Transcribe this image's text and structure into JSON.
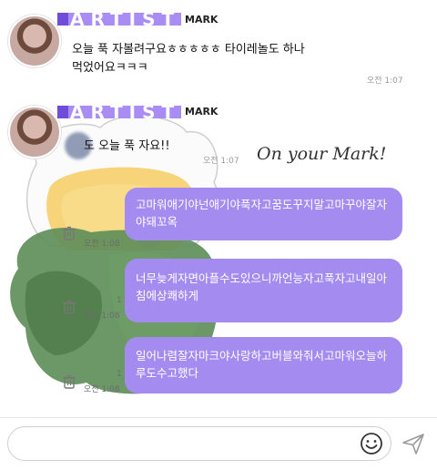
{
  "post1": {
    "badge": "ARTIST",
    "artist": "MARK",
    "message": "오늘 푹 자볼려구요ㅎㅎㅎㅎㅎ 타이레놀도 하나\n먹었어요ㅋㅋㅋ",
    "time": "오전 1:07"
  },
  "post2": {
    "badge": "ARTIST",
    "artist": "MARK",
    "message": "도 오늘 푹 자요!!",
    "time": "오전 1:07",
    "handwriting": "On your Mark!"
  },
  "replies": [
    {
      "text": "고마워애기야넌애기야푹자고꿈도꾸지말고마꾸야잘자야돼꼬옥",
      "time": "오전 1:08"
    },
    {
      "text": "너무늦게자면아플수도있으니까언능자고푹자고내일아침에상쾌하게",
      "time": "오전 1:08"
    },
    {
      "text": "일어나렴잘자마크야사랑하고버블와줘서고마워오늘하루도수고했다",
      "time": "오전 1:08"
    }
  ],
  "reply_marks": [
    "1",
    "1",
    "1"
  ],
  "input": {
    "placeholder": ""
  },
  "colors": {
    "accent": "#a48bf0",
    "badge": "#a98df2",
    "badge_dark": "#6f4cd9"
  },
  "icons": {
    "emoji": "smiley-icon",
    "send": "send-icon",
    "delete": "trash-icon"
  }
}
